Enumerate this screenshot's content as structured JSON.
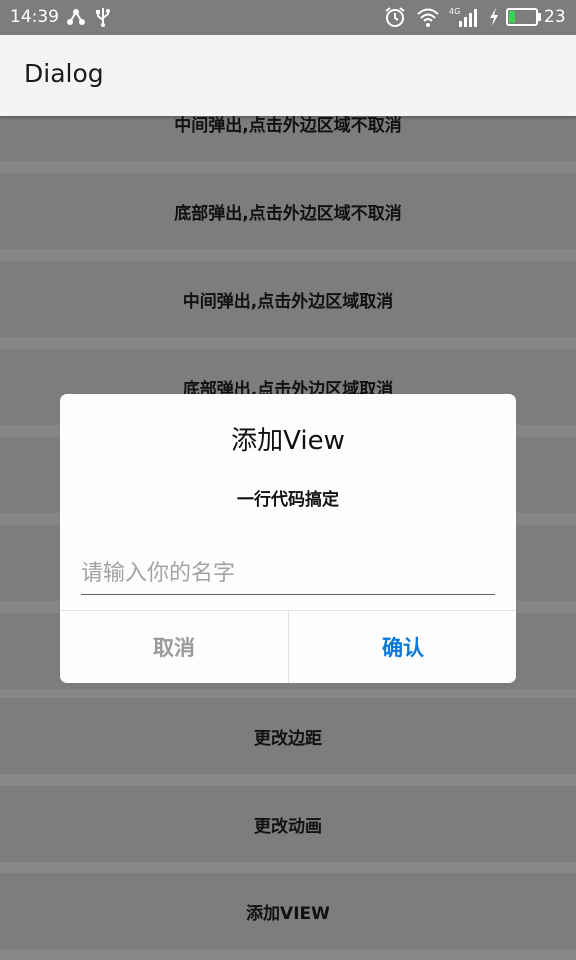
{
  "status_bar": {
    "time": "14:39",
    "network_badge": "4G",
    "battery_level": "23",
    "battery_fraction": 0.23,
    "icons": [
      "share-icon",
      "usb-icon",
      "alarm-icon",
      "wifi-icon",
      "signal-icon",
      "charging-icon",
      "battery-icon"
    ]
  },
  "app_bar": {
    "title": "Dialog"
  },
  "list": {
    "items": [
      {
        "label": "中间弹出,点击外边区域不取消"
      },
      {
        "label": "底部弹出,点击外边区域不取消"
      },
      {
        "label": "中间弹出,点击外边区域取消"
      },
      {
        "label": "底部弹出,点击外边区域取消"
      },
      {
        "label": ""
      },
      {
        "label": ""
      },
      {
        "label": ""
      },
      {
        "label": "更改边距"
      },
      {
        "label": "更改动画"
      },
      {
        "label": "添加VIEW"
      }
    ]
  },
  "dialog": {
    "title": "添加View",
    "subtitle": "一行代码搞定",
    "input_placeholder": "请输入你的名字",
    "input_value": "",
    "cancel_label": "取消",
    "confirm_label": "确认"
  },
  "colors": {
    "dim_background": "#868887",
    "list_button": "#7c7d7c",
    "dialog_background": "#fdfdfd",
    "confirm_accent": "#0a78d8",
    "cancel_text": "#9a9a9a"
  }
}
